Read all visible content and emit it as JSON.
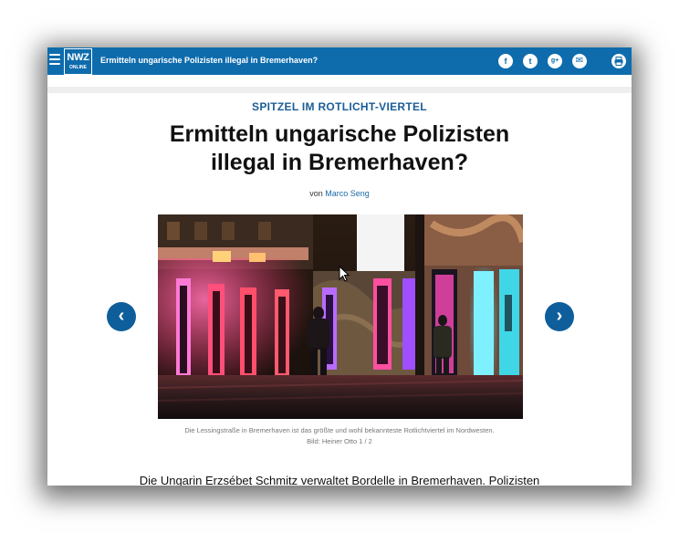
{
  "topbar": {
    "logo_line1": "NWZ",
    "logo_line2": "ONLINE",
    "title": "Ermitteln ungarische Polizisten illegal in Bremerhaven?",
    "social": [
      {
        "icon": "facebook-icon",
        "glyph": "f"
      },
      {
        "icon": "twitter-icon",
        "glyph": "t"
      },
      {
        "icon": "google-plus-icon",
        "glyph": "g+"
      },
      {
        "icon": "email-icon",
        "glyph": "✉"
      }
    ],
    "print_icon": "print-icon",
    "color": "#0e6cad"
  },
  "article": {
    "kicker": "SPITZEL IM ROTLICHT-VIERTEL",
    "headline_line1": "Ermitteln ungarische Polizisten",
    "headline_line2": "illegal in Bremerhaven?",
    "byline_prefix": "von",
    "author": "Marco Seng",
    "caption": "Die Lessingstraße in Bremerhaven ist das größte und wohl bekannteste Rotlichtviertel im Nordwesten.",
    "credit": "Bild: Heiner Otto 1 / 2",
    "lead": "Die Ungarin Erzsébet Schmitz verwaltet Bordelle in Bremerhaven. Polizisten"
  },
  "gallery": {
    "prev_glyph": "‹",
    "next_glyph": "›",
    "accent": "#0e5e9b"
  }
}
